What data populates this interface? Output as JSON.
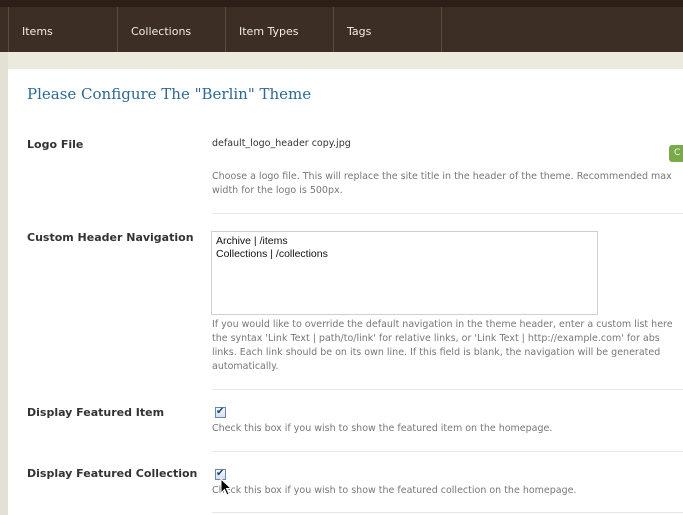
{
  "nav": {
    "tabs": [
      {
        "label": "Items"
      },
      {
        "label": "Collections"
      },
      {
        "label": "Item Types"
      },
      {
        "label": "Tags"
      }
    ]
  },
  "page": {
    "title": "Please Configure The \"Berlin\" Theme"
  },
  "logo_file": {
    "label": "Logo File",
    "filename": "default_logo_header copy.jpg",
    "button_label": "C",
    "help_lines": [
      "Choose a logo file. This will replace the site title in the header of the theme. Recommended max",
      "width for the logo is 500px."
    ]
  },
  "custom_nav": {
    "label": "Custom Header Navigation",
    "lines": [
      "Archive | /items",
      "Collections | /collections"
    ],
    "help_lines": [
      "If you would like to override the default navigation in the theme header, enter a custom list here",
      "the syntax 'Link Text | path/to/link' for relative links, or 'Link Text | http://example.com' for abs",
      "links. Each link should be on its own line. If this field is blank, the navigation will be generated",
      "automatically."
    ]
  },
  "featured_item": {
    "label": "Display Featured Item",
    "checked": true,
    "help": "Check this box if you wish to show the featured item on the homepage."
  },
  "featured_collection": {
    "label": "Display Featured Collection",
    "checked": true,
    "help": "Check this box if you wish to show the featured collection on the homepage."
  },
  "colors": {
    "nav_bg": "#3c2e24",
    "title": "#2b6a94",
    "button": "#7aa94a"
  }
}
